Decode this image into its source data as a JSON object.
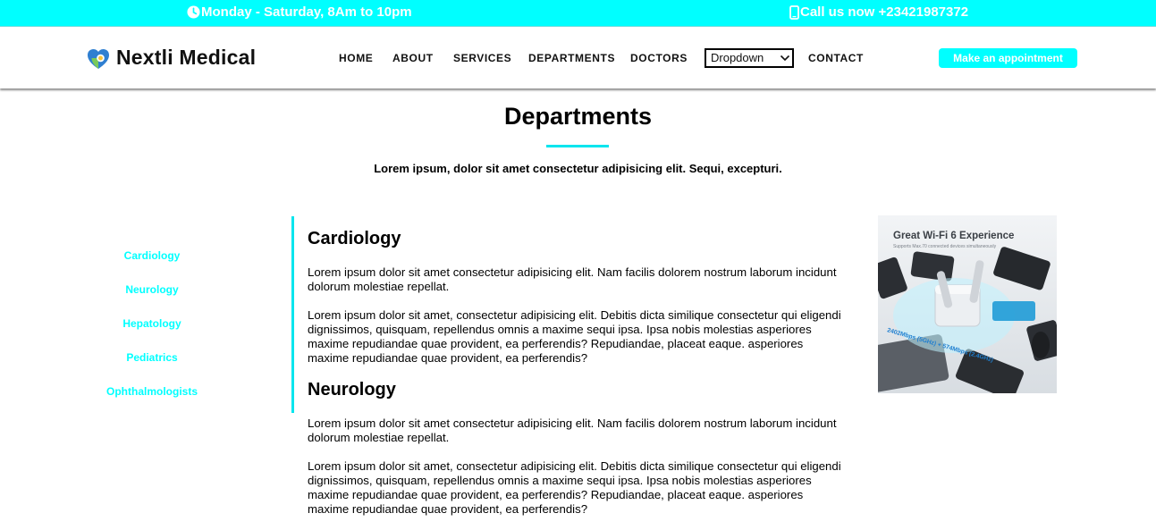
{
  "topbar": {
    "hours": "Monday - Saturday, 8Am to 10pm",
    "phone": "Call us now +23421987372",
    "hours_icon": "clock-icon",
    "phone_icon": "mobile-phone-icon"
  },
  "brand": {
    "name": "Nextli Medical",
    "logo_icon": "heart-shield-logo"
  },
  "nav": {
    "home": "HOME",
    "about": "ABOUT",
    "services": "SERVICES",
    "departments": "DEPARTMENTS",
    "doctors": "DOCTORS",
    "dropdown": "Dropdown",
    "contact": "CONTACT"
  },
  "appointment_button": "Make an appointment",
  "section": {
    "title": "Departments",
    "subtitle": "Lorem ipsum, dolor sit amet consectetur adipisicing elit. Sequi, excepturi."
  },
  "departments_list": [
    "Cardiology",
    "Neurology",
    "Hepatology",
    "Pediatrics",
    "Ophthalmologists"
  ],
  "articles": [
    {
      "heading": "Cardiology",
      "p1": "Lorem ipsum dolor sit amet consectetur adipisicing elit. Nam facilis dolorem nostrum laborum incidunt dolorum molestiae repellat.",
      "p2": "Lorem ipsum dolor sit amet, consectetur adipisicing elit. Debitis dicta similique consectetur qui eligendi dignissimos, quisquam, repellendus omnis a maxime sequi ipsa. Ipsa nobis molestias asperiores maxime repudiandae quae provident, ea perferendis? Repudiandae, placeat eaque. asperiores maxime repudiandae quae provident, ea perferendis?"
    },
    {
      "heading": "Neurology",
      "p1": "Lorem ipsum dolor sit amet consectetur adipisicing elit. Nam facilis dolorem nostrum laborum incidunt dolorum molestiae repellat.",
      "p2": "Lorem ipsum dolor sit amet, consectetur adipisicing elit. Debitis dicta similique consectetur qui eligendi dignissimos, quisquam, repellendus omnis a maxime sequi ipsa. Ipsa nobis molestias asperiores maxime repudiandae quae provident, ea perferendis? Repudiandae, placeat eaque. asperiores maxime repudiandae quae provident, ea perferendis?"
    }
  ],
  "photo": {
    "headline": "Great Wi-Fi 6 Experience",
    "caption": "Supports Max.70 connected devices simultaneously",
    "speed": "2402Mbps (5GHz) + 574Mbps (2.4GHz)"
  },
  "colors": {
    "accent": "#00ffff",
    "divider": "#00e5ee"
  }
}
